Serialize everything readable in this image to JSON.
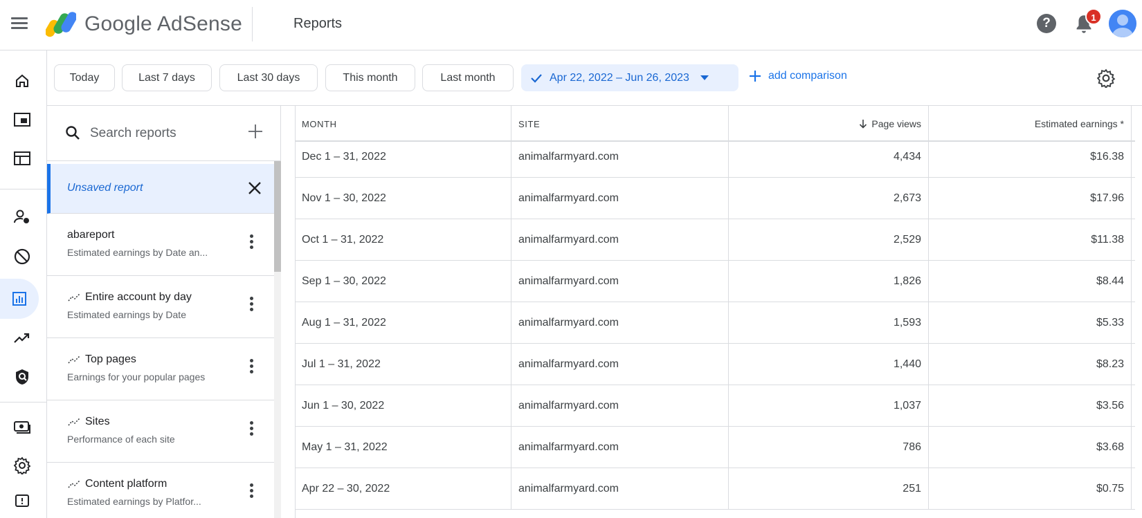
{
  "app": {
    "brand": "Google AdSense",
    "page_title": "Reports",
    "notification_count": "1",
    "help_glyph": "?"
  },
  "rail": {
    "icons": [
      "home-icon",
      "ads-icon",
      "sites-icon",
      "privacy-messaging-icon",
      "blocking-controls-icon",
      "reports-icon",
      "optimization-icon",
      "brand-safety-icon",
      "payments-icon",
      "account-settings-icon",
      "feedback-icon"
    ],
    "active": "reports-icon"
  },
  "filters": {
    "chips": [
      "Today",
      "Last 7 days",
      "Last 30 days",
      "This month",
      "Last month"
    ],
    "date_range": "Apr 22, 2022 – Jun 26, 2023",
    "add_comparison": "add comparison"
  },
  "reports_panel": {
    "search_placeholder": "Search reports",
    "unsaved": "Unsaved report",
    "items": [
      {
        "title": "abareport",
        "subtitle": "Estimated earnings by Date an...",
        "suggested": false
      },
      {
        "title": "Entire account by day",
        "subtitle": "Estimated earnings by Date",
        "suggested": true
      },
      {
        "title": "Top pages",
        "subtitle": "Earnings for your popular pages",
        "suggested": true
      },
      {
        "title": "Sites",
        "subtitle": "Performance of each site",
        "suggested": true
      },
      {
        "title": "Content platform",
        "subtitle": "Estimated earnings by Platfor...",
        "suggested": true
      }
    ]
  },
  "table": {
    "headers": {
      "month": "MONTH",
      "site": "SITE",
      "page_views": "Page views",
      "earnings": "Estimated earnings *"
    },
    "rows": [
      {
        "month": "Dec 1 – 31, 2022",
        "site": "animalfarmyard.com",
        "page_views": "4,434",
        "earnings": "$16.38"
      },
      {
        "month": "Nov 1 – 30, 2022",
        "site": "animalfarmyard.com",
        "page_views": "2,673",
        "earnings": "$17.96"
      },
      {
        "month": "Oct 1 – 31, 2022",
        "site": "animalfarmyard.com",
        "page_views": "2,529",
        "earnings": "$11.38"
      },
      {
        "month": "Sep 1 – 30, 2022",
        "site": "animalfarmyard.com",
        "page_views": "1,826",
        "earnings": "$8.44"
      },
      {
        "month": "Aug 1 – 31, 2022",
        "site": "animalfarmyard.com",
        "page_views": "1,593",
        "earnings": "$5.33"
      },
      {
        "month": "Jul 1 – 31, 2022",
        "site": "animalfarmyard.com",
        "page_views": "1,440",
        "earnings": "$8.23"
      },
      {
        "month": "Jun 1 – 30, 2022",
        "site": "animalfarmyard.com",
        "page_views": "1,037",
        "earnings": "$3.56"
      },
      {
        "month": "May 1 – 31, 2022",
        "site": "animalfarmyard.com",
        "page_views": "786",
        "earnings": "$3.68"
      },
      {
        "month": "Apr 22 – 30, 2022",
        "site": "animalfarmyard.com",
        "page_views": "251",
        "earnings": "$0.75"
      }
    ]
  },
  "colors": {
    "accent": "#1a73e8",
    "selected_bg": "#e8f0fe",
    "badge": "#d93025"
  }
}
